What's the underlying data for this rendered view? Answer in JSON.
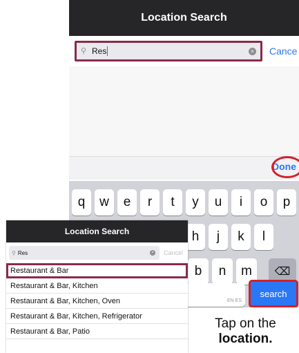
{
  "main_screen": {
    "title": "Location Search",
    "search": {
      "value": "Res",
      "clear_icon": "x-circle-icon"
    },
    "cancel_label": "Cance",
    "done_label": "Done",
    "keyboard": {
      "row1": [
        "q",
        "w",
        "e",
        "r",
        "t",
        "y",
        "u",
        "i",
        "o",
        "p"
      ],
      "row2": [
        "h",
        "j",
        "k",
        "l"
      ],
      "row3": [
        "b",
        "n",
        "m"
      ],
      "backspace_icon": "backspace-icon",
      "space_hint": "EN ES",
      "search_label": "search"
    }
  },
  "overlay_screen": {
    "title": "Location Search",
    "search": {
      "value": "Res"
    },
    "cancel_label": "Cancel",
    "results": [
      "Restaurant & Bar",
      "Restaurant & Bar, Kitchen",
      "Restaurant & Bar, Kitchen, Oven",
      "Restaurant & Bar, Kitchen, Refrigerator",
      "Restaurant & Bar, Patio"
    ]
  },
  "caption": {
    "line1": "Tap on the",
    "line2": "location."
  },
  "colors": {
    "header": "#262629",
    "accent": "#2a78f6",
    "highlight_border": "#8a2a4a",
    "annotation_red": "#d3202a"
  }
}
